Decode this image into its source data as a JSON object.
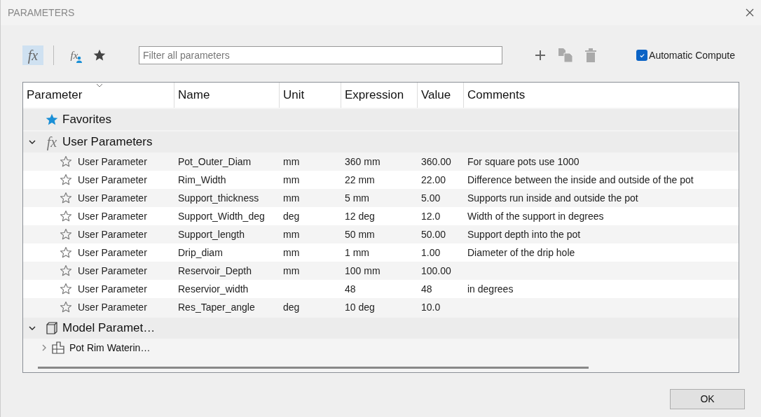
{
  "window": {
    "title": "PARAMETERS"
  },
  "toolbar": {
    "filters": [
      {
        "kind": "all",
        "symbol": "fx",
        "selected": true
      },
      {
        "kind": "user",
        "symbol": "fx",
        "selected": false
      },
      {
        "kind": "favorites",
        "selected": false
      }
    ],
    "search": {
      "placeholder": "Filter all parameters"
    },
    "automatic_compute": {
      "label": "Automatic Compute",
      "checked": true
    }
  },
  "table": {
    "columns": [
      "Parameter",
      "Name",
      "Unit",
      "Expression",
      "Value",
      "Comments"
    ],
    "groups": [
      {
        "kind": "favorites",
        "label": "Favorites"
      },
      {
        "kind": "user",
        "symbol": "fx",
        "label": "User Parameters",
        "expanded": true,
        "rows": [
          {
            "favorite": false,
            "parameter": "User Parameter",
            "name": "Pot_Outer_Diam",
            "unit": "mm",
            "expression": "360 mm",
            "value": "360.00",
            "comment": "For square pots use 1000"
          },
          {
            "favorite": false,
            "parameter": "User Parameter",
            "name": "Rim_Width",
            "unit": "mm",
            "expression": "22 mm",
            "value": "22.00",
            "comment": "Difference between the inside and outside of the pot"
          },
          {
            "favorite": false,
            "parameter": "User Parameter",
            "name": "Support_thickness",
            "unit": "mm",
            "expression": "5 mm",
            "value": "5.00",
            "comment": "Supports run inside and outside the pot"
          },
          {
            "favorite": false,
            "parameter": "User Parameter",
            "name": "Support_Width_deg",
            "unit": "deg",
            "expression": "12 deg",
            "value": "12.0",
            "comment": "Width of the support in degrees"
          },
          {
            "favorite": false,
            "parameter": "User Parameter",
            "name": "Support_length",
            "unit": "mm",
            "expression": "50 mm",
            "value": "50.00",
            "comment": "Support depth into the pot"
          },
          {
            "favorite": false,
            "parameter": "User Parameter",
            "name": "Drip_diam",
            "unit": "mm",
            "expression": "1 mm",
            "value": "1.00",
            "comment": "Diameter of the drip hole"
          },
          {
            "favorite": false,
            "parameter": "User Parameter",
            "name": "Reservoir_Depth",
            "unit": "mm",
            "expression": "100 mm",
            "value": "100.00"
          },
          {
            "favorite": false,
            "parameter": "User Parameter",
            "name": "Reservior_width",
            "expression": "48",
            "value": "48",
            "comment": "in degrees"
          },
          {
            "favorite": false,
            "parameter": "User Parameter",
            "name": "Res_Taper_angle",
            "unit": "deg",
            "expression": "10 deg",
            "value": "10.0"
          }
        ]
      },
      {
        "kind": "model",
        "label": "Model Paramet…",
        "expanded": true,
        "children": [
          {
            "label": "Pot Rim Waterin…",
            "expanded": false
          }
        ]
      }
    ]
  },
  "buttons": [
    {
      "label": "OK"
    }
  ]
}
